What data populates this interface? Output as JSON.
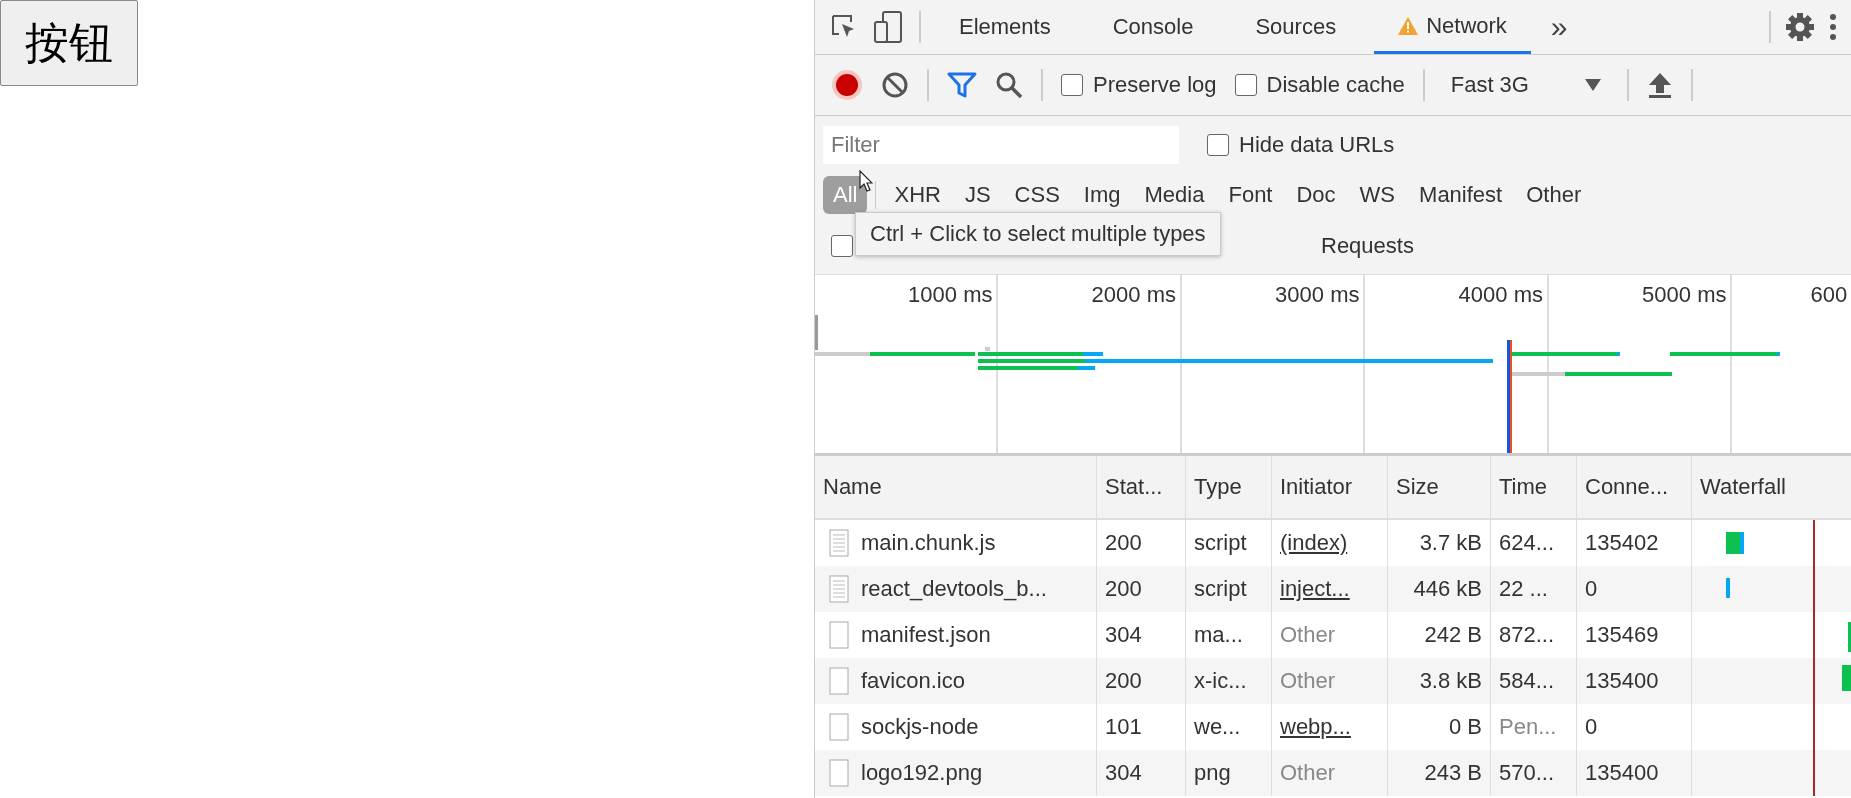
{
  "page": {
    "button": "按钮"
  },
  "devtools": {
    "tabs": [
      {
        "label": "Elements",
        "selected": false,
        "warning": false
      },
      {
        "label": "Console",
        "selected": false,
        "warning": false
      },
      {
        "label": "Sources",
        "selected": false,
        "warning": false
      },
      {
        "label": "Network",
        "selected": true,
        "warning": true
      }
    ],
    "more_tabs": "»",
    "toolbar": {
      "recording": true,
      "filter_active": true,
      "preserve_log": {
        "label": "Preserve log",
        "checked": false
      },
      "disable_cache": {
        "label": "Disable cache",
        "checked": false
      },
      "throttling": "Fast 3G"
    },
    "filter": {
      "placeholder": "Filter",
      "hide_data_urls": {
        "label": "Hide data URLs",
        "checked": false
      }
    },
    "types": [
      {
        "label": "All",
        "selected": true
      },
      {
        "label": "XHR",
        "selected": false
      },
      {
        "label": "JS",
        "selected": false
      },
      {
        "label": "CSS",
        "selected": false
      },
      {
        "label": "Img",
        "selected": false
      },
      {
        "label": "Media",
        "selected": false
      },
      {
        "label": "Font",
        "selected": false
      },
      {
        "label": "Doc",
        "selected": false
      },
      {
        "label": "WS",
        "selected": false
      },
      {
        "label": "Manifest",
        "selected": false
      },
      {
        "label": "Other",
        "selected": false
      }
    ],
    "blocked_row": {
      "checked": false,
      "visible_text": "Requests"
    },
    "tooltip": "Ctrl + Click to select multiple types",
    "overview": {
      "ticks": [
        "1000 ms",
        "2000 ms",
        "3000 ms",
        "4000 ms",
        "5000 ms",
        "600"
      ]
    },
    "table": {
      "columns": [
        "Name",
        "Stat...",
        "Type",
        "Initiator",
        "Size",
        "Time",
        "Conne...",
        "Waterfall"
      ],
      "rows": [
        {
          "kind": "lined",
          "name": "main.chunk.js",
          "status": "200",
          "type": "script",
          "initiator": "(index)",
          "initiator_linked": true,
          "size": "3.7 kB",
          "time": "624...",
          "pending": false,
          "connection": "135402"
        },
        {
          "kind": "lined",
          "name": "react_devtools_b...",
          "status": "200",
          "type": "script",
          "initiator": "inject...",
          "initiator_linked": true,
          "size": "446 kB",
          "time": "22 ...",
          "pending": false,
          "connection": "0"
        },
        {
          "kind": "blank",
          "name": "manifest.json",
          "status": "304",
          "type": "ma...",
          "initiator": "Other",
          "initiator_linked": false,
          "size": "242 B",
          "time": "872...",
          "pending": false,
          "connection": "135469"
        },
        {
          "kind": "blank",
          "name": "favicon.ico",
          "status": "200",
          "type": "x-ic...",
          "initiator": "Other",
          "initiator_linked": false,
          "size": "3.8 kB",
          "time": "584...",
          "pending": false,
          "connection": "135400"
        },
        {
          "kind": "blank",
          "name": "sockjs-node",
          "status": "101",
          "type": "we...",
          "initiator": "webp...",
          "initiator_linked": true,
          "size": "0 B",
          "time": "Pen...",
          "pending": true,
          "connection": "0"
        },
        {
          "kind": "blank",
          "name": "logo192.png",
          "status": "304",
          "type": "png",
          "initiator": "Other",
          "initiator_linked": false,
          "size": "243 B",
          "time": "570...",
          "pending": false,
          "connection": "135400"
        }
      ]
    }
  }
}
